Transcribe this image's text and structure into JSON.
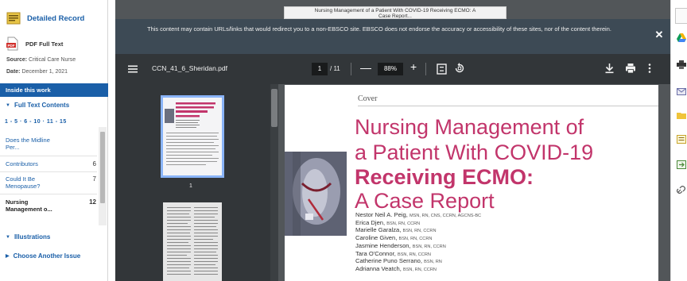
{
  "sidebar": {
    "detailed_record_label": "Detailed Record",
    "pdf_full_text_label": "PDF Full Text",
    "source_label": "Source:",
    "source_value": "Critical Care Nurse",
    "date_label": "Date:",
    "date_value": "December 1, 2021",
    "inside_this_work": "Inside this work",
    "full_text_contents": "Full Text Contents",
    "page_nav": "1 - 5 · 6 - 10 · 11 - 15",
    "toc": [
      {
        "title_line1": "Does the Midline",
        "title_line2": "Per...",
        "page": ""
      },
      {
        "title_line1": "Contributors",
        "title_line2": "",
        "page": "6"
      },
      {
        "title_line1": "Could It Be",
        "title_line2": "Menopause?",
        "page": "7"
      },
      {
        "title_line1": "Nursing",
        "title_line2": "Management o...",
        "page": "12"
      }
    ],
    "illustrations": "Illustrations",
    "choose_another_issue": "Choose Another Issue"
  },
  "viewer": {
    "tab_title_line1": "Nursing Management of a Patient With COVID-19 Receiving ECMO: A",
    "tab_title_line2": "Case Report...",
    "notice": "This content may contain URLs/links that would redirect you to a non-EBSCO site. EBSCO does not endorse the accuracy or accessibility of these sites, nor of the content therein.",
    "close_glyph": "✕",
    "filename": "CCN_41_6_Sheridan.pdf",
    "current_page": "1",
    "total_pages": "/ 11",
    "zoom": "88%",
    "minus": "—",
    "plus": "+",
    "thumbnail_label": "1"
  },
  "pdf_page": {
    "section": "Cover",
    "headline_1": "Nursing Management of",
    "headline_2": "a Patient With COVID-19",
    "headline_3": "Receiving ECMO:",
    "headline_4": "A Case Report",
    "authors": [
      {
        "name": "Nestor Neil A. Peig,",
        "cred": "MSN, RN, CNS, CCRN, AGCNS-BC"
      },
      {
        "name": "Erica Djen,",
        "cred": "BSN, RN, CCRN"
      },
      {
        "name": "Marielle Garalza,",
        "cred": "BSN, RN, CCRN"
      },
      {
        "name": "Caroline Given,",
        "cred": "BSN, RN, CCRN"
      },
      {
        "name": "Jasmine Henderson,",
        "cred": "BSN, RN, CCRN"
      },
      {
        "name": "Tara O'Connor,",
        "cred": "BSN, RN, CCRN"
      },
      {
        "name": "Catherine Puno Serrano,",
        "cred": "BSN, RN"
      },
      {
        "name": "Adrianna Veatch,",
        "cred": "BSN, RN, CCRN"
      }
    ]
  },
  "colors": {
    "ebsco_blue": "#1a5fa8",
    "pdf_toolbar": "#323639",
    "viewer_background": "#525659",
    "headline_magenta": "#c2356b",
    "thumbnail_highlight": "#8ab4f8"
  },
  "icons": [
    "detailed-record-icon",
    "pdf-icon",
    "menu-icon",
    "fit-page-icon",
    "rotate-icon",
    "download-icon",
    "print-icon",
    "more-options-icon",
    "close-icon"
  ]
}
